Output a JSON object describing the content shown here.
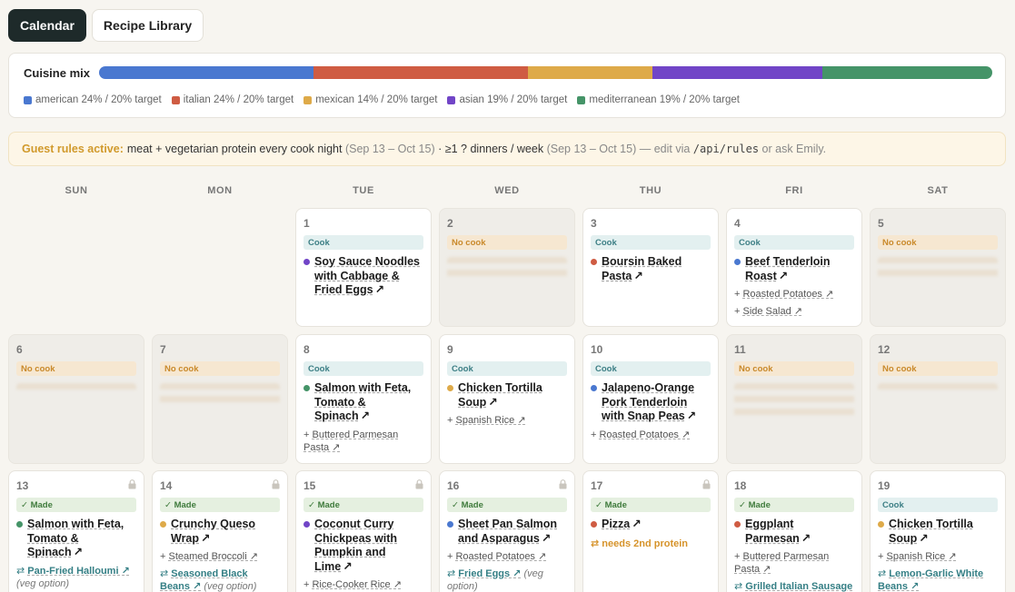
{
  "tabs": [
    {
      "label": "Calendar",
      "active": true
    },
    {
      "label": "Recipe Library",
      "active": false
    }
  ],
  "cuisine_mix": {
    "title": "Cuisine mix",
    "segments": [
      {
        "name": "american",
        "pct": 24,
        "color": "#4a78d0",
        "label": "american 24% / 20% target"
      },
      {
        "name": "italian",
        "pct": 24,
        "color": "#cf5c43",
        "label": "italian 24% / 20% target"
      },
      {
        "name": "mexican",
        "pct": 14,
        "color": "#deaa49",
        "label": "mexican 14% / 20% target"
      },
      {
        "name": "asian",
        "pct": 19,
        "color": "#7145c7",
        "label": "asian 19% / 20% target"
      },
      {
        "name": "mediterranean",
        "pct": 19,
        "color": "#459468",
        "label": "mediterranean 19% / 20% target"
      }
    ]
  },
  "rules": {
    "label": "Guest rules active:",
    "rule1": "meat + vegetarian protein every cook night",
    "range1": "(Sep 13 – Oct 15)",
    "sep": "·",
    "rule2": "≥1 ? dinners / week",
    "range2": "(Sep 13 – Oct 15)",
    "edit": "— edit via",
    "code": "/api/rules",
    "tail": "or ask Emily."
  },
  "weekdays": [
    "SUN",
    "MON",
    "TUE",
    "WED",
    "THU",
    "FRI",
    "SAT"
  ],
  "status": {
    "cook": "Cook",
    "no": "No cook",
    "made": "✓ Made"
  },
  "days": {
    "d1": {
      "num": "1",
      "title": "Soy Sauce Noodles with Cabbage & Fried Eggs",
      "arrow": "↗"
    },
    "d2": {
      "num": "2"
    },
    "d3": {
      "num": "3",
      "title": "Boursin Baked Pasta",
      "arrow": "↗"
    },
    "d4": {
      "num": "4",
      "title": "Beef Tenderloin Roast",
      "arrow": "↗",
      "side1": "Roasted Potatoes ↗",
      "side2": "Side Salad ↗"
    },
    "d5": {
      "num": "5"
    },
    "d6": {
      "num": "6"
    },
    "d7": {
      "num": "7"
    },
    "d8": {
      "num": "8",
      "title": "Salmon with Feta, Tomato & Spinach",
      "arrow": "↗",
      "side1": "Buttered Parmesan Pasta ↗"
    },
    "d9": {
      "num": "9",
      "title": "Chicken Tortilla Soup",
      "arrow": "↗",
      "side1": "Spanish Rice ↗"
    },
    "d10": {
      "num": "10",
      "title": "Jalapeno-Orange Pork Tenderloin with Snap Peas",
      "arrow": "↗",
      "side1": "Roasted Potatoes ↗"
    },
    "d11": {
      "num": "11"
    },
    "d12": {
      "num": "12"
    },
    "d13": {
      "num": "13",
      "title": "Salmon with Feta, Tomato & Spinach",
      "arrow": "↗",
      "alt": "Pan-Fried Halloumi ↗",
      "veg": "(veg option)"
    },
    "d14": {
      "num": "14",
      "title": "Crunchy Queso Wrap",
      "arrow": "↗",
      "side1": "Steamed Broccoli ↗",
      "alt": "Seasoned Black Beans ↗",
      "veg": "(veg option)"
    },
    "d15": {
      "num": "15",
      "title": "Coconut Curry Chickpeas with Pumpkin and Lime",
      "arrow": "↗",
      "side1": "Rice-Cooker Rice ↗"
    },
    "d16": {
      "num": "16",
      "title": "Sheet Pan Salmon and Asparagus",
      "arrow": "↗",
      "side1": "Roasted Potatoes ↗",
      "alt": "Fried Eggs ↗",
      "veg": "(veg option)"
    },
    "d17": {
      "num": "17",
      "title": "Pizza",
      "arrow": "↗",
      "warn": "⇄ needs 2nd protein"
    },
    "d18": {
      "num": "18",
      "title": "Eggplant Parmesan",
      "arrow": "↗",
      "side1": "Buttered Parmesan Pasta ↗",
      "alt": "Grilled Italian Sausage"
    },
    "d19": {
      "num": "19",
      "title": "Chicken Tortilla Soup",
      "arrow": "↗",
      "side1": "Spanish Rice ↗",
      "alt": "Lemon-Garlic White Beans ↗"
    }
  },
  "colors": {
    "american": "#4a78d0",
    "italian": "#cf5c43",
    "mexican": "#deaa49",
    "asian": "#7145c7",
    "mediterranean": "#459468"
  }
}
